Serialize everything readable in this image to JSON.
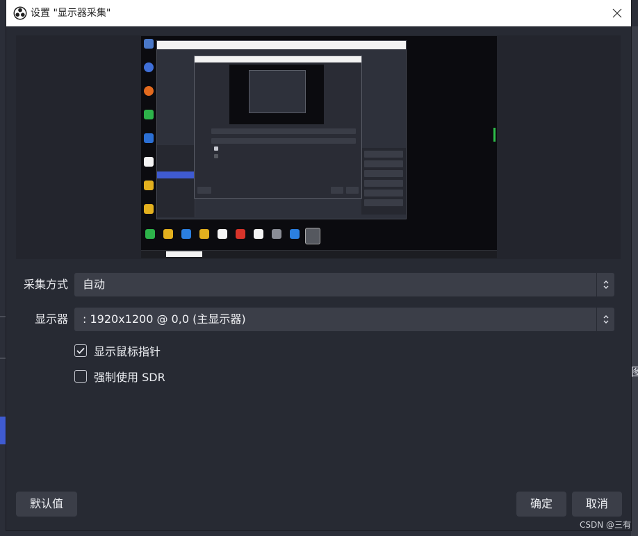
{
  "dialog": {
    "title": "设置 \"显示器采集\"",
    "close_icon": "close-icon",
    "app_icon": "obs-logo-icon"
  },
  "form": {
    "capture_method": {
      "label": "采集方式",
      "value": "自动"
    },
    "display": {
      "label": "显示器",
      "value": ": 1920x1200 @ 0,0 (主显示器)"
    },
    "show_cursor": {
      "label": "显示鼠标指针",
      "checked": true
    },
    "force_sdr": {
      "label": "强制使用 SDR",
      "checked": false
    }
  },
  "footer": {
    "defaults_label": "默认值",
    "ok_label": "确定",
    "cancel_label": "取消"
  },
  "watermark": "CSDN @三有",
  "backdrop": {
    "cut_text": "图"
  },
  "colors": {
    "dialog_bg": "#272a33",
    "field_bg": "#3b3e48",
    "accent_blue": "#3f5bd1",
    "meter_green": "#2ec04a"
  }
}
